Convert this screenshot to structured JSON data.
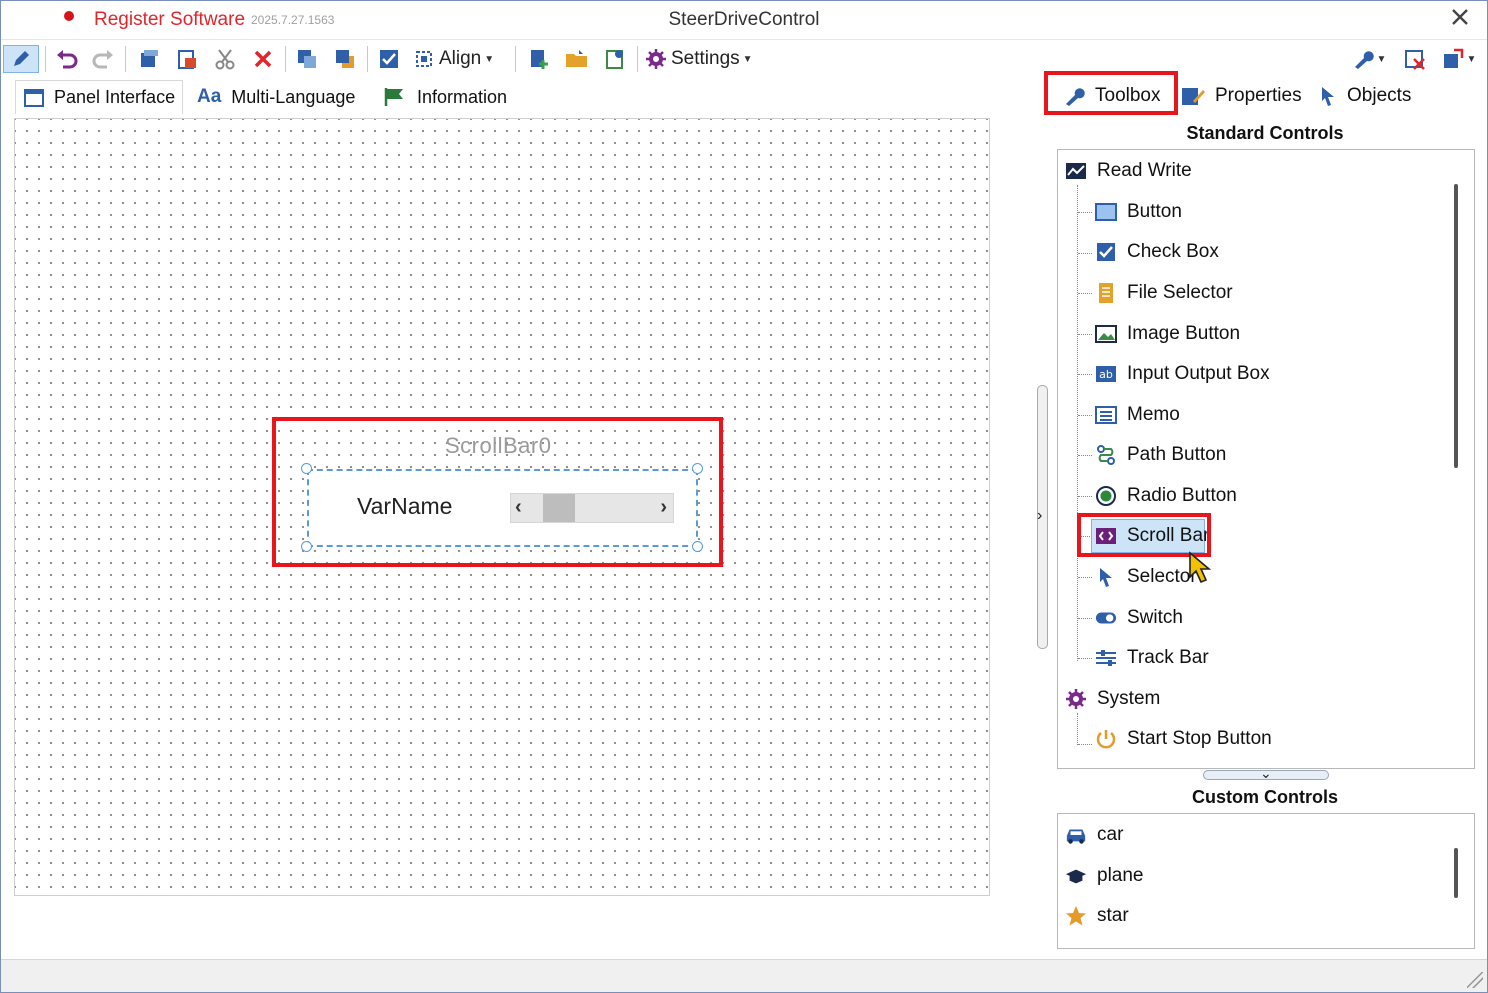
{
  "title": {
    "register": "Register Software",
    "version": "2025.7.27.1563",
    "app": "SteerDriveControl"
  },
  "toolbar": {
    "align_label": "Align",
    "settings_label": "Settings"
  },
  "left_tabs": [
    {
      "label": "Panel Interface",
      "icon": "panel-icon"
    },
    {
      "label": "Multi-Language",
      "icon": "font-icon"
    },
    {
      "label": "Information",
      "icon": "info-flag-icon"
    }
  ],
  "canvas": {
    "component_name": "ScrollBar0",
    "variable_label": "VarName"
  },
  "right_tabs": [
    {
      "label": "Toolbox",
      "icon": "wrench-icon"
    },
    {
      "label": "Properties",
      "icon": "properties-icon"
    },
    {
      "label": "Objects",
      "icon": "pointer-icon"
    }
  ],
  "standard_controls": {
    "title": "Standard Controls",
    "groups": [
      {
        "label": "Read Write",
        "icon": "chart-icon",
        "items": [
          {
            "label": "Button",
            "icon": "button-icon"
          },
          {
            "label": "Check Box",
            "icon": "checkbox-icon"
          },
          {
            "label": "File Selector",
            "icon": "file-icon"
          },
          {
            "label": "Image Button",
            "icon": "image-icon"
          },
          {
            "label": "Input Output Box",
            "icon": "ab-icon"
          },
          {
            "label": "Memo",
            "icon": "memo-icon"
          },
          {
            "label": "Path Button",
            "icon": "path-icon"
          },
          {
            "label": "Radio Button",
            "icon": "radio-icon"
          },
          {
            "label": "Scroll Bar",
            "icon": "scrollbar-icon",
            "selected": true
          },
          {
            "label": "Selector",
            "icon": "pointer-icon"
          },
          {
            "label": "Switch",
            "icon": "switch-icon"
          },
          {
            "label": "Track Bar",
            "icon": "trackbar-icon"
          }
        ]
      },
      {
        "label": "System",
        "icon": "gear-icon",
        "items": [
          {
            "label": "Start Stop Button",
            "icon": "start-stop-icon"
          }
        ]
      }
    ]
  },
  "custom_controls": {
    "title": "Custom Controls",
    "items": [
      {
        "label": "car",
        "icon": "car-icon"
      },
      {
        "label": "plane",
        "icon": "plane-icon"
      },
      {
        "label": "star",
        "icon": "star-icon"
      }
    ]
  },
  "colors": {
    "highlight": "#e8161c",
    "selection": "#5a9bd5",
    "accent": "#2e5fa8"
  }
}
